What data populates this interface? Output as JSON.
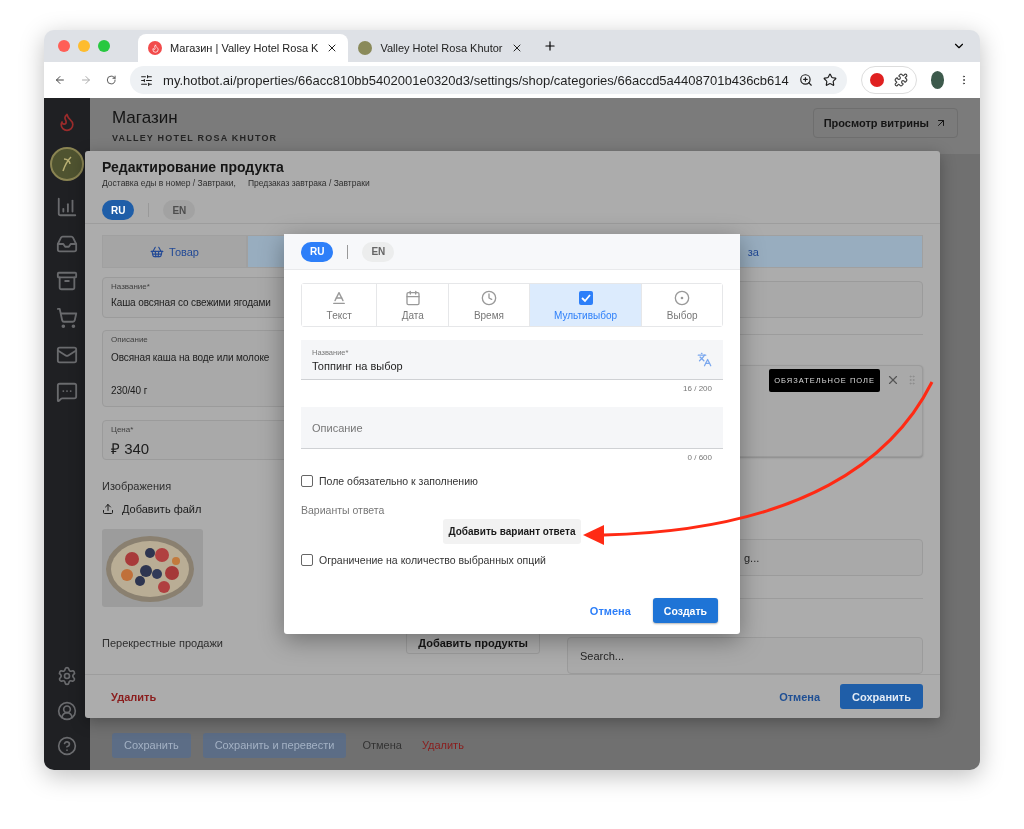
{
  "browser": {
    "tabs": [
      {
        "title": "Магазин | Valley Hotel Rosa K",
        "selected": true
      },
      {
        "title": "Valley Hotel Rosa Khutor",
        "selected": false
      }
    ],
    "url": "my.hotbot.ai/properties/66acc810bb5402001e0320d3/settings/shop/categories/66accd5a4408701b436cb614"
  },
  "header": {
    "title": "Магазин",
    "subtitle": "VALLEY HOTEL ROSA KHUTOR",
    "storefront_button": "Просмотр витрины"
  },
  "product_modal": {
    "title": "Редактирование продукта",
    "breadcrumbs": [
      "Доставка еды в номер / Завтраки,",
      "Предзаказ завтрака / Завтраки"
    ],
    "languages": [
      {
        "label": "RU",
        "selected": true
      },
      {
        "label": "EN",
        "selected": false
      }
    ],
    "tabs": [
      {
        "label": "Товар",
        "selected": false
      },
      {
        "label": "за",
        "selected": true
      }
    ],
    "name": {
      "label": "Название*",
      "value": "Каша овсяная со свежими ягодами"
    },
    "description": {
      "label": "Описание",
      "lines": [
        "Овсяная каша на воде или молоке",
        "230/40 г"
      ]
    },
    "price": {
      "label": "Цена*",
      "currency": "₽",
      "value": "340"
    },
    "images": {
      "label": "Изображения",
      "add_button": "Добавить файл"
    },
    "cross_sales": {
      "label": "Перекрестные продажи",
      "button": "Добавить продукты"
    },
    "required_badge": "ОБЯЗАТЕЛЬНОЕ ПОЛЕ",
    "option_field": "g...",
    "search": {
      "placeholder": "Search..."
    },
    "footer": {
      "delete": "Удалить",
      "cancel": "Отмена",
      "save": "Сохранить"
    }
  },
  "page_footer": {
    "buttons": [
      "Сохранить",
      "Сохранить и перевести"
    ],
    "cancel": "Отмена",
    "delete": "Удалить"
  },
  "dialog": {
    "languages": [
      {
        "label": "RU",
        "selected": true
      },
      {
        "label": "EN",
        "selected": false
      }
    ],
    "field_types": [
      {
        "label": "Текст",
        "kind": "text",
        "selected": false
      },
      {
        "label": "Дата",
        "kind": "date",
        "selected": false
      },
      {
        "label": "Время",
        "kind": "time",
        "selected": false
      },
      {
        "label": "Мультивыбор",
        "kind": "multi",
        "selected": true
      },
      {
        "label": "Выбор",
        "kind": "single",
        "selected": false
      }
    ],
    "name_field": {
      "label": "Название*",
      "value": "Топпинг на выбор",
      "counter": "16 / 200"
    },
    "description_field": {
      "placeholder": "Описание",
      "counter": "0 / 600"
    },
    "required_checkbox": {
      "label": "Поле обязательно к заполнению",
      "checked": false
    },
    "options_label": "Варианты ответа",
    "add_option_button": "Добавить вариант ответа",
    "limit_checkbox": {
      "label": "Ограничение на количество выбранных опций",
      "checked": false
    },
    "cancel": "Отмена",
    "create": "Создать"
  }
}
